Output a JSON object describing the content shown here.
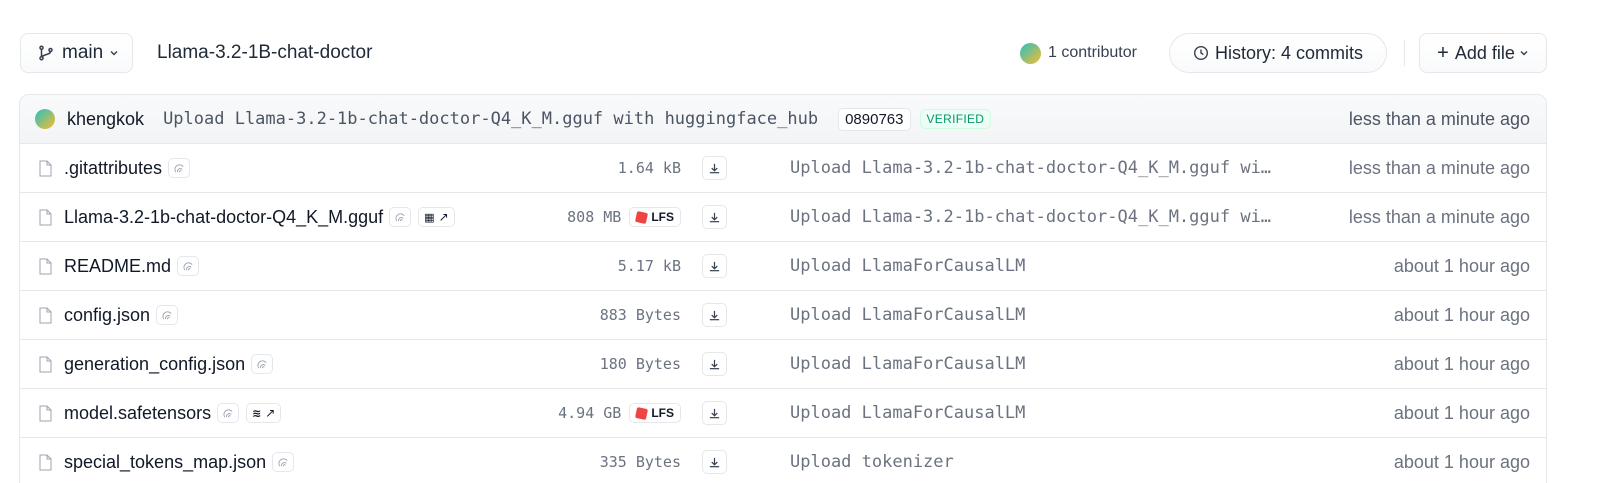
{
  "header": {
    "branch_label": "main",
    "repo_name": "Llama-3.2-1B-chat-doctor",
    "contributors_label": "1 contributor",
    "history_label": "History: 4 commits",
    "add_file_label": "Add file"
  },
  "latest_commit": {
    "author": "khengkok",
    "message": "Upload Llama-3.2-1b-chat-doctor-Q4_K_M.gguf with huggingface_hub",
    "hash": "0890763",
    "verified_label": "VERIFIED",
    "time": "less than a minute ago"
  },
  "files": [
    {
      "name": ".gitattributes",
      "size": "1.64 kB",
      "lfs": false,
      "ext_badge": false,
      "message": "Upload Llama-3.2-1b-chat-doctor-Q4_K_M.gguf wi…",
      "time": "less than a minute ago"
    },
    {
      "name": "Llama-3.2-1b-chat-doctor-Q4_K_M.gguf",
      "size": "808 MB",
      "lfs": true,
      "lfs_label": "LFS",
      "ext_badge": true,
      "ext_icon": "gguf-icon",
      "message": "Upload Llama-3.2-1b-chat-doctor-Q4_K_M.gguf wi…",
      "time": "less than a minute ago"
    },
    {
      "name": "README.md",
      "size": "5.17 kB",
      "lfs": false,
      "ext_badge": false,
      "message": "Upload LlamaForCausalLM",
      "time": "about 1 hour ago"
    },
    {
      "name": "config.json",
      "size": "883 Bytes",
      "lfs": false,
      "ext_badge": false,
      "message": "Upload LlamaForCausalLM",
      "time": "about 1 hour ago"
    },
    {
      "name": "generation_config.json",
      "size": "180 Bytes",
      "lfs": false,
      "ext_badge": false,
      "message": "Upload LlamaForCausalLM",
      "time": "about 1 hour ago"
    },
    {
      "name": "model.safetensors",
      "size": "4.94 GB",
      "lfs": true,
      "lfs_label": "LFS",
      "ext_badge": true,
      "ext_icon": "safetensors-icon",
      "message": "Upload LlamaForCausalLM",
      "time": "about 1 hour ago"
    },
    {
      "name": "special_tokens_map.json",
      "size": "335 Bytes",
      "lfs": false,
      "ext_badge": false,
      "message": "Upload tokenizer",
      "time": "about 1 hour ago"
    }
  ],
  "colors": {
    "verified": "#059669",
    "lfs_cube": "#ef4444",
    "border": "#e5e7eb"
  }
}
